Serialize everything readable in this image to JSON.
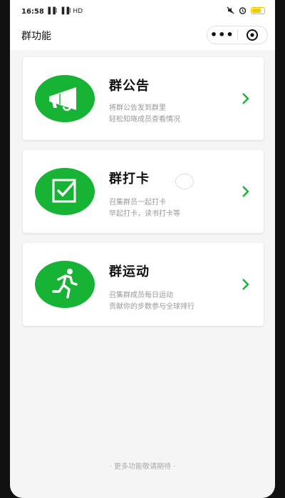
{
  "status_bar": {
    "time": "16:58",
    "signal": "▐▐l ▐▐l HD",
    "icons": [
      "mute-icon",
      "alarm-icon",
      "battery-icon"
    ]
  },
  "nav": {
    "title": "群功能",
    "more_label": "•••"
  },
  "cards": [
    {
      "title": "群公告",
      "lines": [
        "将群公告发到群里",
        "轻松知晓成员查看情况"
      ],
      "icon": "megaphone-icon"
    },
    {
      "title": "群打卡",
      "lines": [
        "召集群员一起打卡",
        "早起打卡，读书打卡等"
      ],
      "icon": "checkbox-icon"
    },
    {
      "title": "群运动",
      "lines": [
        "召集群成员每日运动",
        "贡献你的步数参与全球排行"
      ],
      "icon": "running-icon"
    }
  ],
  "footer": "· 更多功能敬请期待 ·",
  "colors": {
    "accent": "#17b334",
    "background": "#f5f5f5"
  }
}
